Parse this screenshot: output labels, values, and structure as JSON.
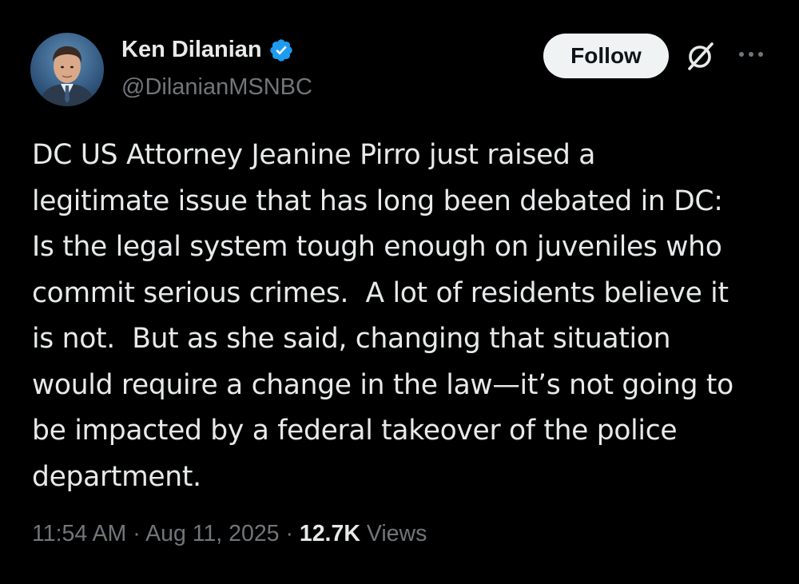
{
  "author": {
    "name": "Ken Dilanian",
    "handle": "@DilanianMSNBC",
    "verified": true,
    "verified_color": "#1d9bf0"
  },
  "actions": {
    "follow_label": "Follow",
    "grok_icon": "grok-icon",
    "more_icon": "more-icon"
  },
  "tweet": {
    "text": "DC US Attorney Jeanine Pirro just raised a\nlegitimate issue that has long been debated in DC:\nIs the legal system tough enough on juveniles who\ncommit serious crimes.  A lot of residents believe it\nis not.  But as she said, changing that situation\nwould require a change in the law—it’s not going to\nbe impacted by a federal takeover of the police\ndepartment."
  },
  "meta": {
    "time": "11:54 AM",
    "separator": " · ",
    "date": "Aug 11, 2025",
    "views_count": "12.7K",
    "views_label": " Views"
  },
  "colors": {
    "background": "#000000",
    "primary_text": "#e7e9ea",
    "secondary_text": "#71767b",
    "follow_bg": "#eff3f4"
  }
}
